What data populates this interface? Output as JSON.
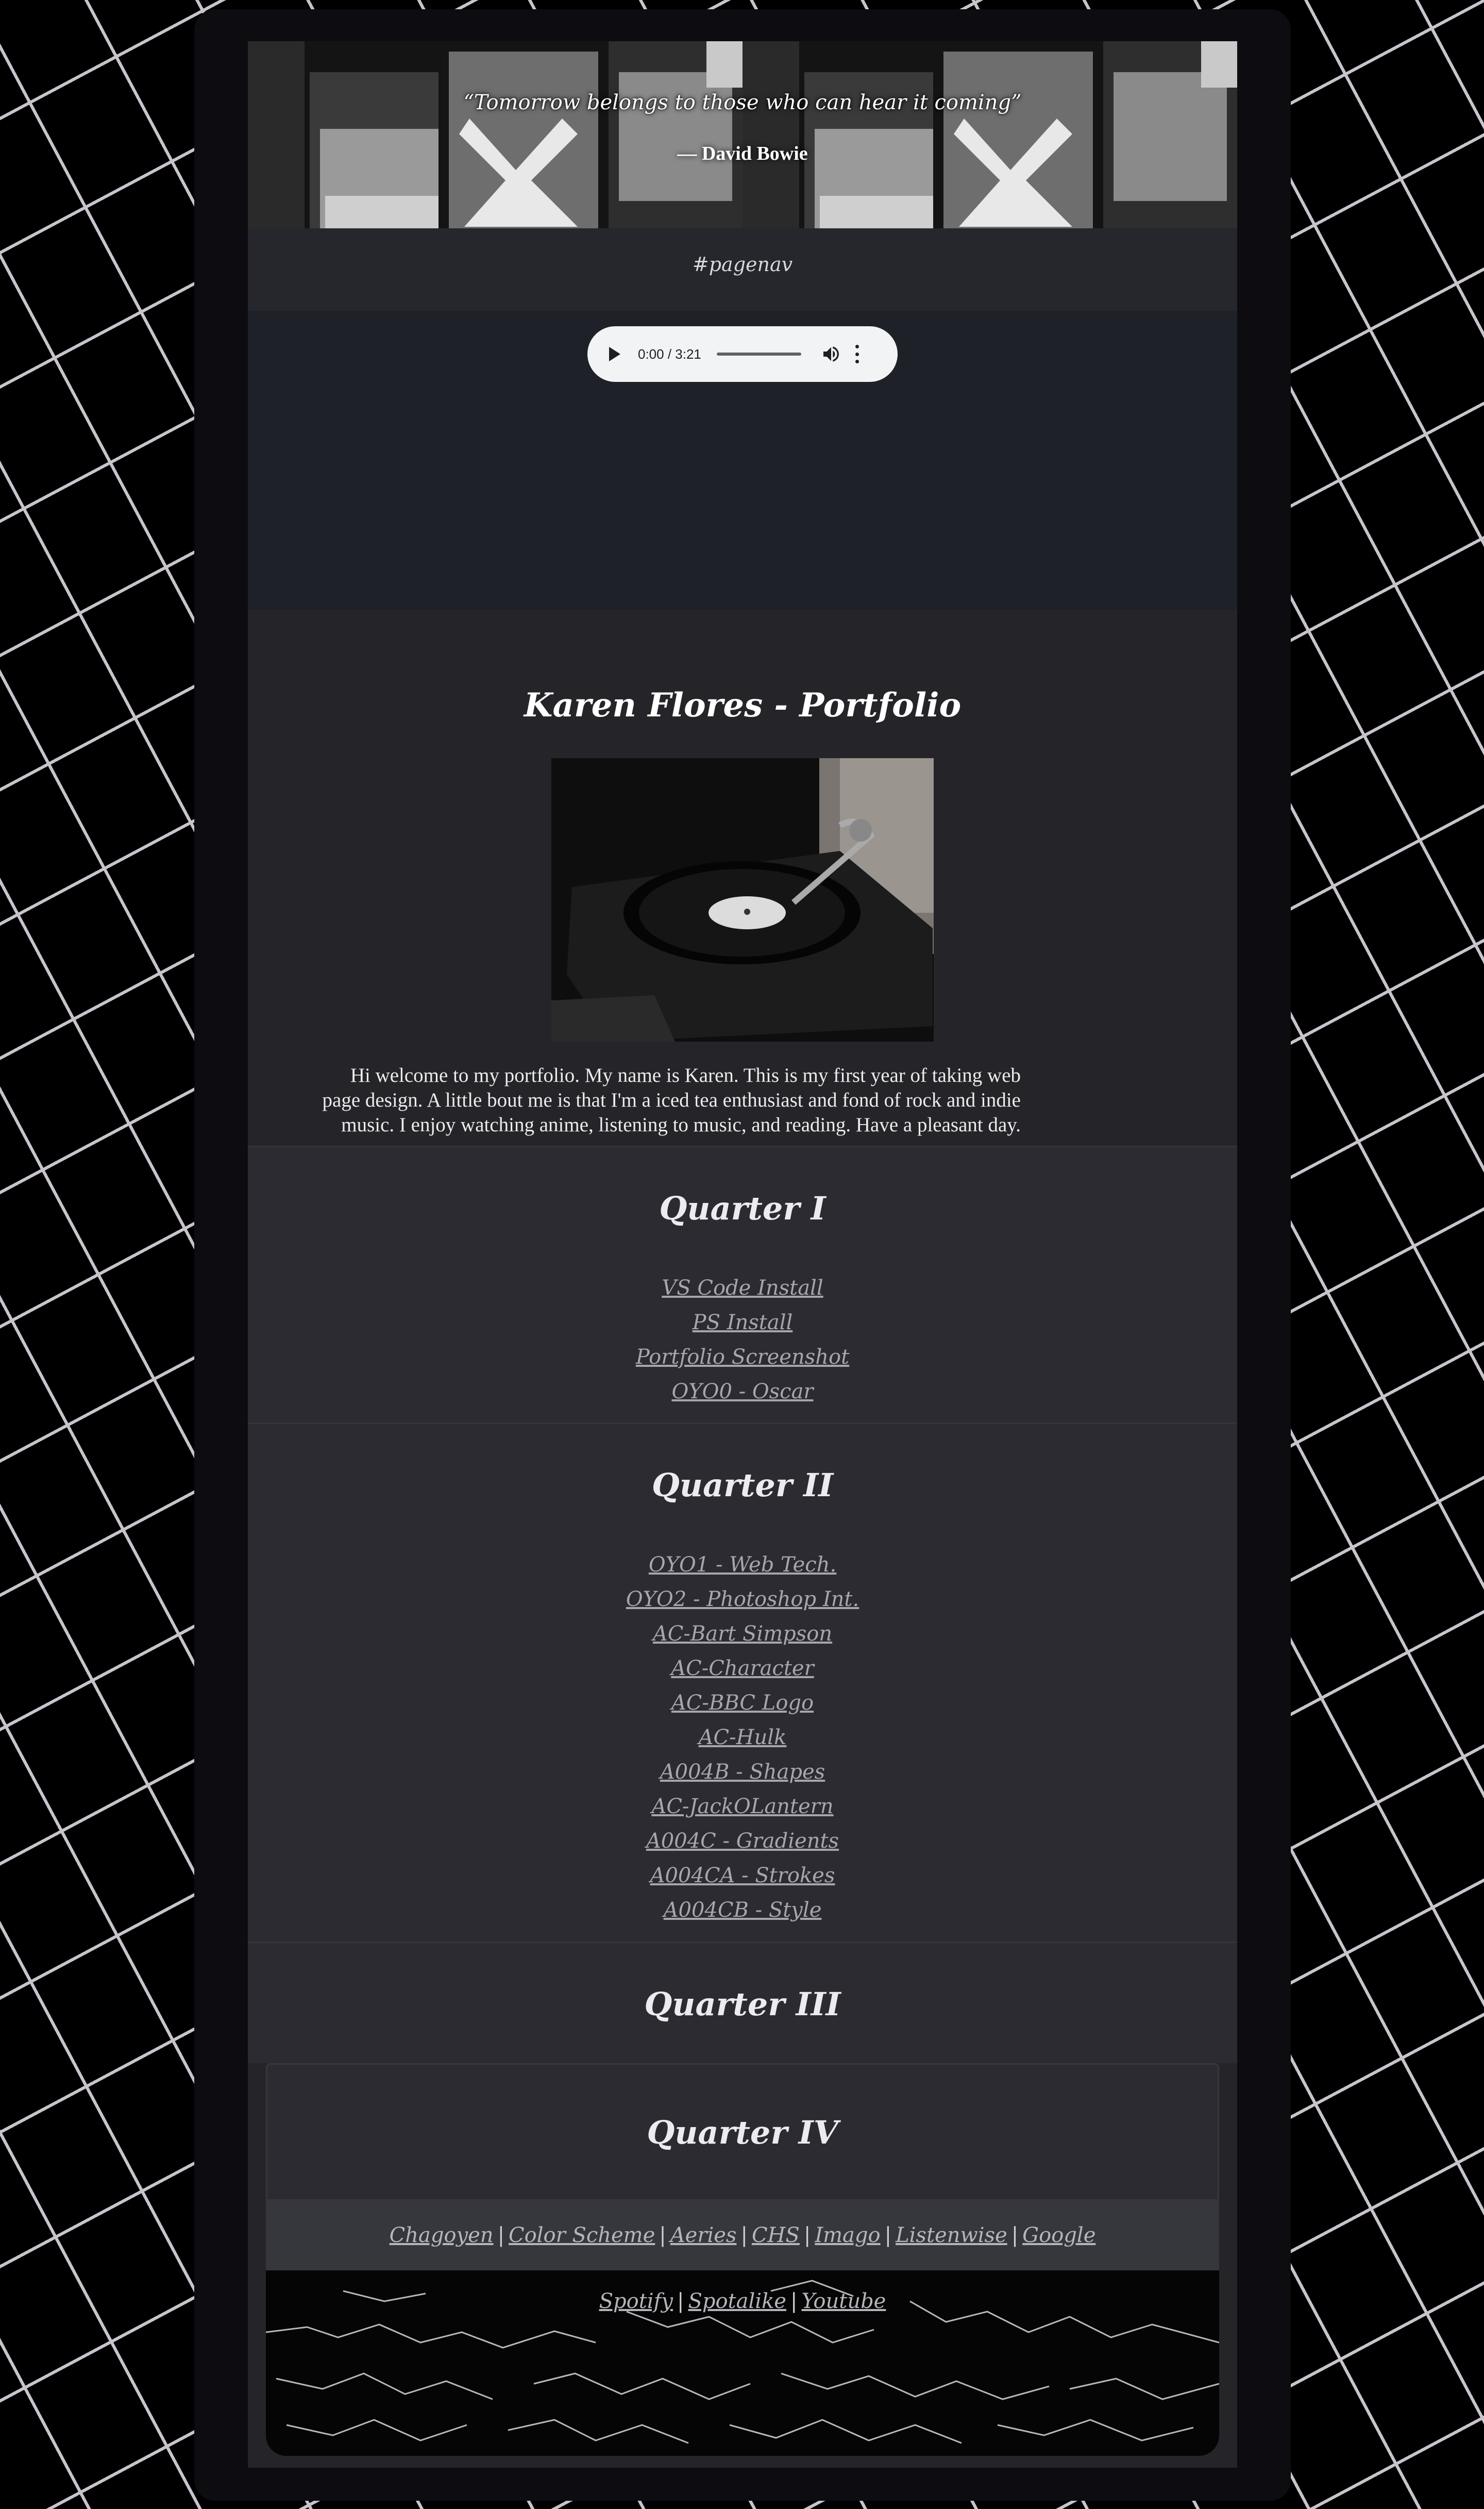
{
  "banner": {
    "quote": "“Tomorrow belongs to those who can hear it coming”",
    "author": "— David Bowie"
  },
  "nav": {
    "label": "#pagenav"
  },
  "audio": {
    "time": "0:00 / 3:21",
    "progress": 0
  },
  "intro": {
    "title": "Karen Flores - Portfolio",
    "bio_lines": [
      "Hi welcome to my portfolio. My name is Karen. This is my first year of taking web",
      "page design. A little bout me is that I'm a iced tea enthusiast and fond of rock and indie",
      "music. I enjoy watching anime, listening to music, and reading. Have a pleasant day."
    ]
  },
  "quarters": [
    {
      "title": "Quarter I",
      "links": [
        "VS Code Install",
        "PS Install",
        "Portfolio Screenshot",
        "OYO0 - Oscar"
      ]
    },
    {
      "title": "Quarter II",
      "links": [
        "OYO1 - Web Tech.",
        "OYO2 - Photoshop Int.",
        "AC-Bart Simpson",
        "AC-Character",
        "AC-BBC Logo",
        "AC-Hulk",
        "A004B - Shapes",
        "AC-JackOLantern",
        "A004C - Gradients",
        "A004CA - Strokes",
        "A004CB - Style"
      ]
    },
    {
      "title": "Quarter III",
      "links": []
    },
    {
      "title": "Quarter IV",
      "links": []
    }
  ],
  "footer": {
    "links": [
      "Chagoyen",
      "Color Scheme",
      "Aeries",
      "CHS",
      "Imago",
      "Listenwise",
      "Google"
    ],
    "separator": "|",
    "music_links": [
      "Spotify",
      "Spotalike",
      "Youtube"
    ]
  }
}
